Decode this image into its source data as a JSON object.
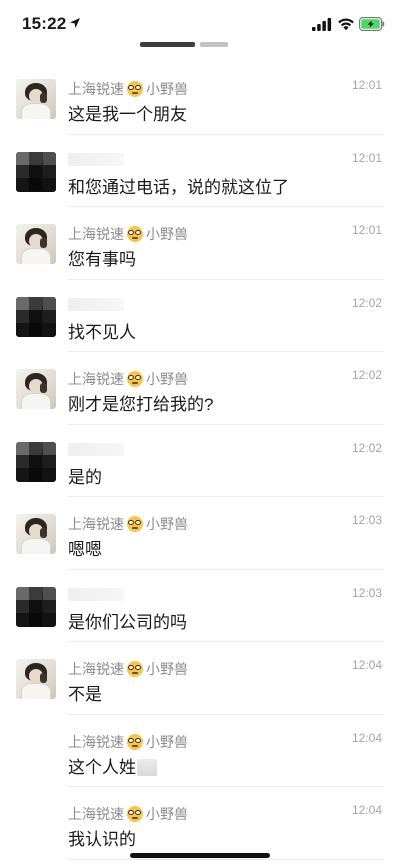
{
  "status_bar": {
    "time": "15:22"
  },
  "messages": [
    {
      "sender": "上海锐速",
      "sender_suffix": "小野兽",
      "avatar": "user",
      "time": "12:01",
      "text": "这是我一个朋友"
    },
    {
      "sender": "",
      "sender_suffix": "",
      "avatar": "blurred",
      "time": "12:01",
      "text": "和您通过电话，说的就这位了"
    },
    {
      "sender": "上海锐速",
      "sender_suffix": "小野兽",
      "avatar": "user",
      "time": "12:01",
      "text": "您有事吗"
    },
    {
      "sender": "",
      "sender_suffix": "",
      "avatar": "blurred",
      "time": "12:02",
      "text": "找不见人"
    },
    {
      "sender": "上海锐速",
      "sender_suffix": "小野兽",
      "avatar": "user",
      "time": "12:02",
      "text": "刚才是您打给我的?"
    },
    {
      "sender": "",
      "sender_suffix": "",
      "avatar": "blurred",
      "time": "12:02",
      "text": "是的"
    },
    {
      "sender": "上海锐速",
      "sender_suffix": "小野兽",
      "avatar": "user",
      "time": "12:03",
      "text": "嗯嗯"
    },
    {
      "sender": "",
      "sender_suffix": "",
      "avatar": "blurred",
      "time": "12:03",
      "text": "是你们公司的吗"
    },
    {
      "sender": "上海锐速",
      "sender_suffix": "小野兽",
      "avatar": "user",
      "time": "12:04",
      "text": "不是"
    },
    {
      "sender": "上海锐速",
      "sender_suffix": "小野兽",
      "avatar": "none",
      "time": "12:04",
      "text": "这个人姓",
      "text_masked": true
    },
    {
      "sender": "上海锐速",
      "sender_suffix": "小野兽",
      "avatar": "none",
      "time": "12:04",
      "text": "我认识的"
    }
  ],
  "colors": {
    "background": "#ffffff",
    "name": "#8c8c8c",
    "time": "#a6a6a6",
    "text": "#1a1a1a",
    "battery": "#4cd964"
  },
  "icons": {
    "location": "location-arrow-icon",
    "signal": "cellular-signal-icon",
    "wifi": "wifi-icon",
    "battery": "battery-charging-icon",
    "emoji": "nerd-face-emoji-icon"
  }
}
